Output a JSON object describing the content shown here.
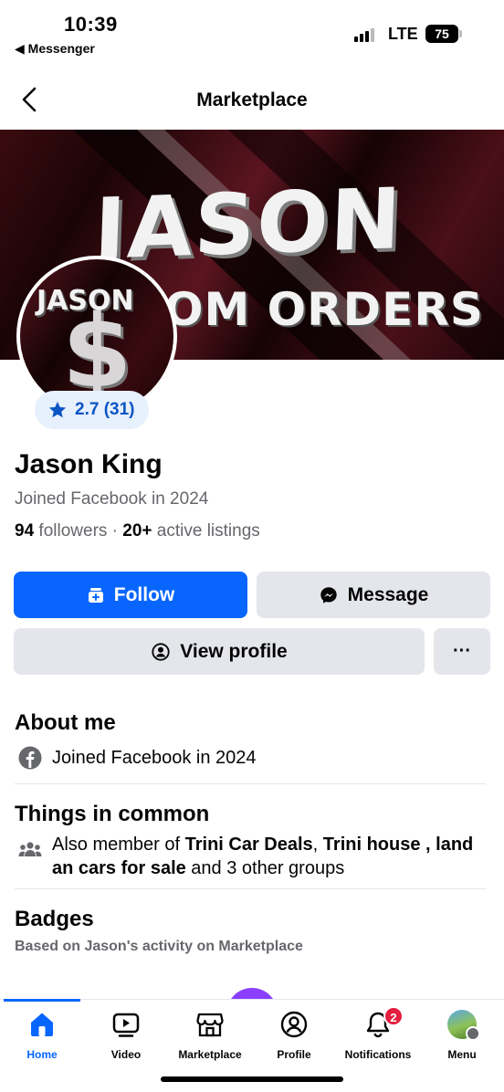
{
  "status_bar": {
    "time": "10:39",
    "back_app": "◀ Messenger",
    "network": "LTE",
    "battery": "75"
  },
  "nav": {
    "title": "Marketplace",
    "back_icon": "chevron-left-icon"
  },
  "cover": {
    "line1": "JASON",
    "line2": "OM ORDERS"
  },
  "avatar": {
    "text": "JASON",
    "symbol": "$"
  },
  "rating": {
    "label": "2.7 (31)",
    "icon": "star-icon"
  },
  "profile": {
    "name": "Jason King",
    "joined": "Joined Facebook in 2024",
    "followers_count": "94",
    "followers_label": " followers · ",
    "listings_count": "20+",
    "listings_label": " active listings"
  },
  "actions": {
    "follow": "Follow",
    "message": "Message",
    "view_profile": "View profile",
    "more": "···"
  },
  "about": {
    "title": "About me",
    "joined": "Joined Facebook in 2024"
  },
  "common": {
    "title": "Things in common",
    "prefix": "Also member of ",
    "group1": "Trini Car Deals",
    "sep": ", ",
    "group2": "Trini house , land an cars for sale",
    "suffix": " and 3 other groups"
  },
  "badges": {
    "title": "Badges",
    "subtitle": "Based on Jason's activity on Marketplace"
  },
  "tabbar": {
    "home": "Home",
    "video": "Video",
    "marketplace": "Marketplace",
    "profile": "Profile",
    "notifications": "Notifications",
    "notifications_count": "2",
    "menu": "Menu",
    "active_color": "#0866ff"
  },
  "colors": {
    "primary": "#0866ff",
    "secondary_button": "#e4e6eb",
    "muted_text": "#65676b",
    "rating_bg": "#e7f0fd",
    "notification_badge": "#e41e3f"
  }
}
